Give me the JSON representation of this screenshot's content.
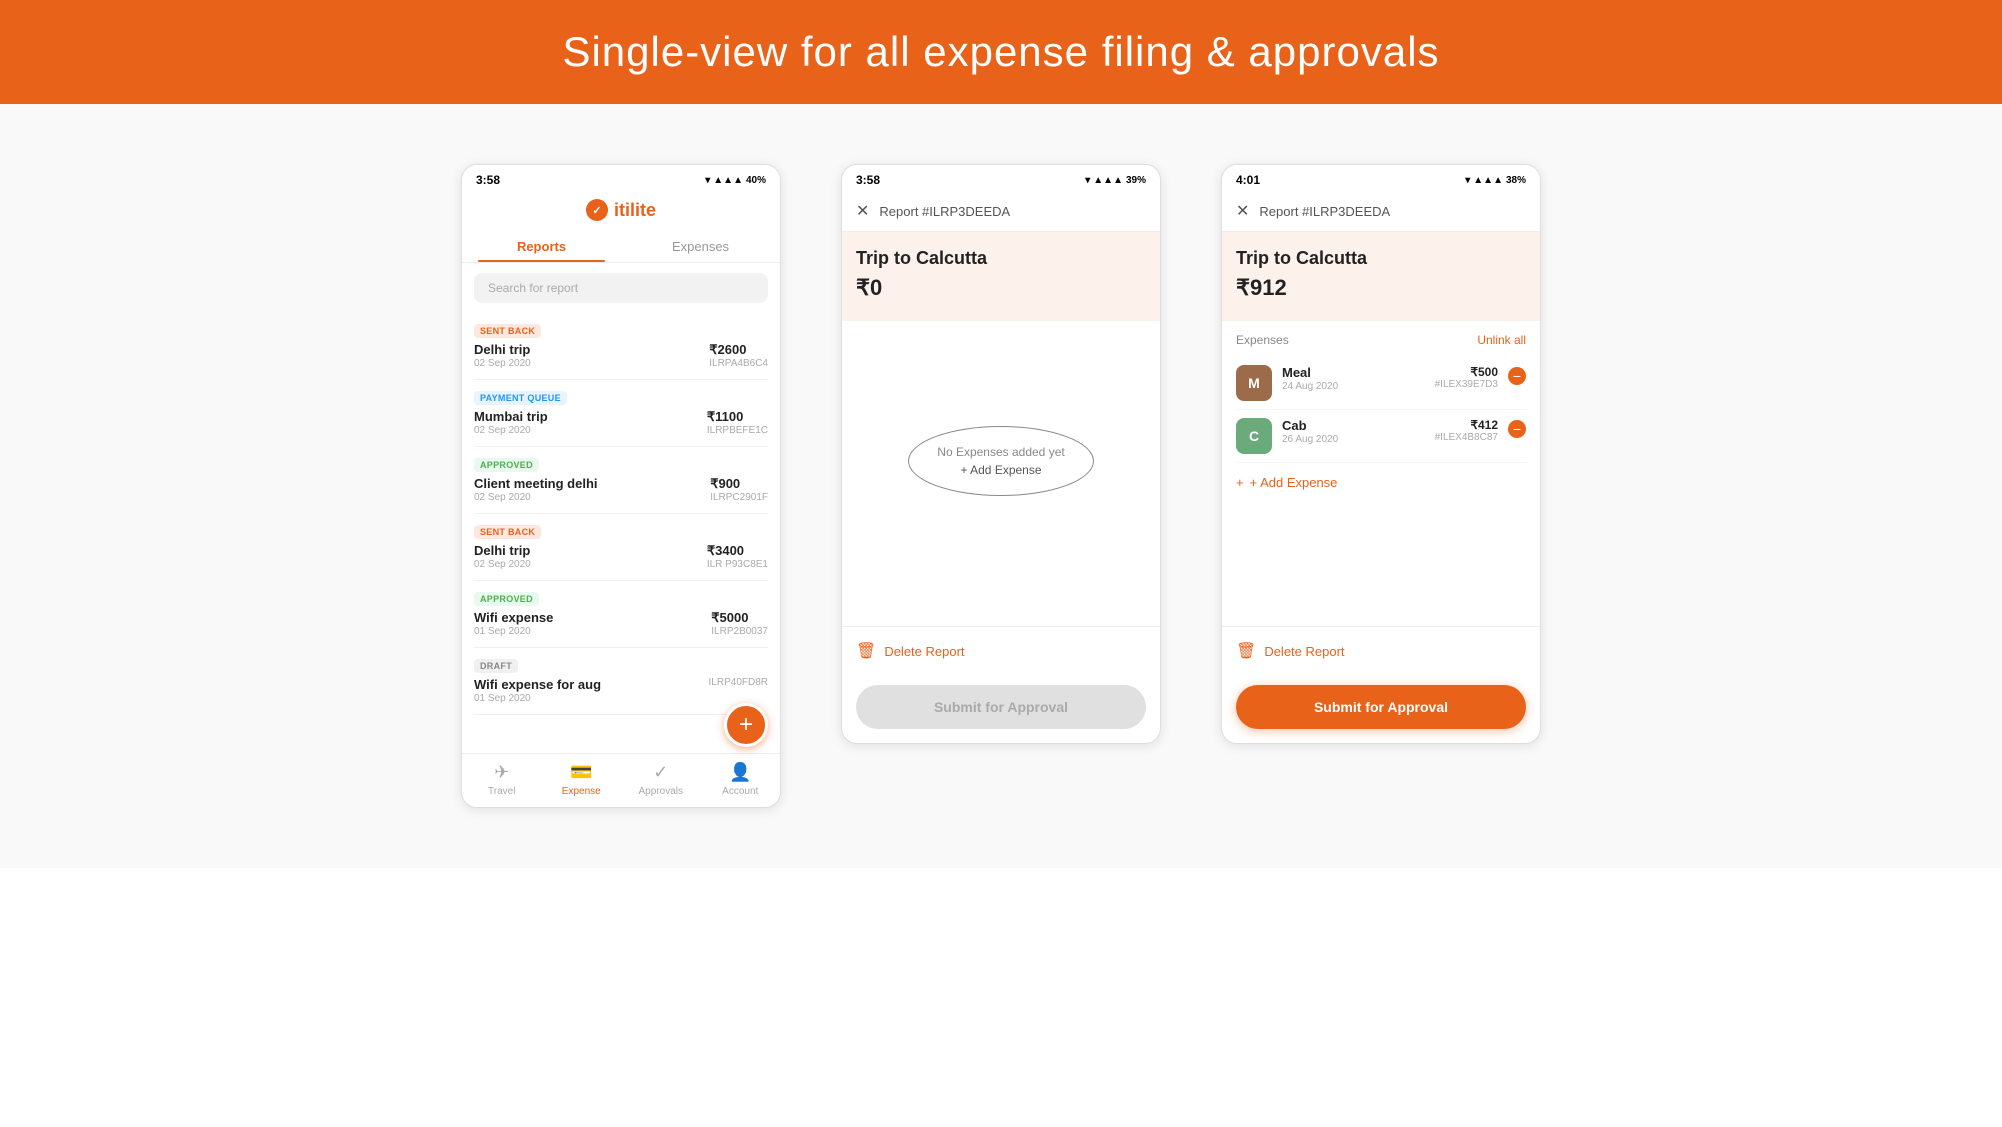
{
  "header": {
    "title": "Single-view for all expense filing & approvals",
    "bg_color": "#E8621A"
  },
  "screen1": {
    "status_bar": {
      "time": "3:58",
      "battery": "40%"
    },
    "logo": "itilite",
    "tabs": [
      {
        "label": "Reports",
        "active": true
      },
      {
        "label": "Expenses",
        "active": false
      }
    ],
    "search_placeholder": "Search for report",
    "reports": [
      {
        "badge": "SENT BACK",
        "badge_type": "sent-back",
        "name": "Delhi trip",
        "date": "02 Sep 2020",
        "amount": "₹2600",
        "id": "ILRPA4B6C4"
      },
      {
        "badge": "PAYMENT QUEUE",
        "badge_type": "payment-queue",
        "name": "Mumbai trip",
        "date": "02 Sep 2020",
        "amount": "₹1100",
        "id": "ILRPBEFE1C"
      },
      {
        "badge": "APPROVED",
        "badge_type": "approved",
        "name": "Client meeting delhi",
        "date": "02 Sep 2020",
        "amount": "₹900",
        "id": "ILRPC2901F"
      },
      {
        "badge": "SENT BACK",
        "badge_type": "sent-back",
        "name": "Delhi trip",
        "date": "02 Sep 2020",
        "amount": "₹3400",
        "id": "ILR P93C8E1"
      },
      {
        "badge": "APPROVED",
        "badge_type": "approved",
        "name": "Wifi expense",
        "date": "01 Sep 2020",
        "amount": "₹5000",
        "id": "ILRP2B0037"
      },
      {
        "badge": "DRAFT",
        "badge_type": "draft",
        "name": "Wifi expense for aug",
        "date": "01 Sep 2020",
        "amount": "",
        "id": "ILRP40FD8R"
      }
    ],
    "nav": [
      {
        "icon": "✈",
        "label": "Travel",
        "active": false
      },
      {
        "icon": "🧾",
        "label": "Expense",
        "active": true
      },
      {
        "icon": "✓",
        "label": "Approvals",
        "active": false
      },
      {
        "icon": "👤",
        "label": "Account",
        "active": false
      }
    ]
  },
  "screen2": {
    "status_bar": {
      "time": "3:58",
      "battery": "39%"
    },
    "header_label": "Report #ILRP3DEEDA",
    "report_name": "Trip to Calcutta",
    "amount": "₹0",
    "empty_text": "No Expenses added yet",
    "add_expense": "+ Add Expense",
    "delete_label": "Delete Report",
    "submit_label": "Submit for Approval",
    "submit_disabled": true
  },
  "screen3": {
    "status_bar": {
      "time": "4:01",
      "battery": "38%"
    },
    "header_label": "Report #ILRP3DEEDA",
    "report_name": "Trip to Calcutta",
    "amount": "₹912",
    "expenses_label": "Expenses",
    "unlink_all": "Unlink all",
    "expenses": [
      {
        "avatar": "M",
        "avatar_type": "meal",
        "name": "Meal",
        "date": "24 Aug 2020",
        "amount": "₹500",
        "id": "#ILEX39E7D3"
      },
      {
        "avatar": "C",
        "avatar_type": "cab",
        "name": "Cab",
        "date": "26 Aug 2020",
        "amount": "₹412",
        "id": "#ILEX4B8C87"
      }
    ],
    "add_expense": "+ Add Expense",
    "delete_label": "Delete Report",
    "submit_label": "Submit for Approval",
    "submit_disabled": false
  }
}
